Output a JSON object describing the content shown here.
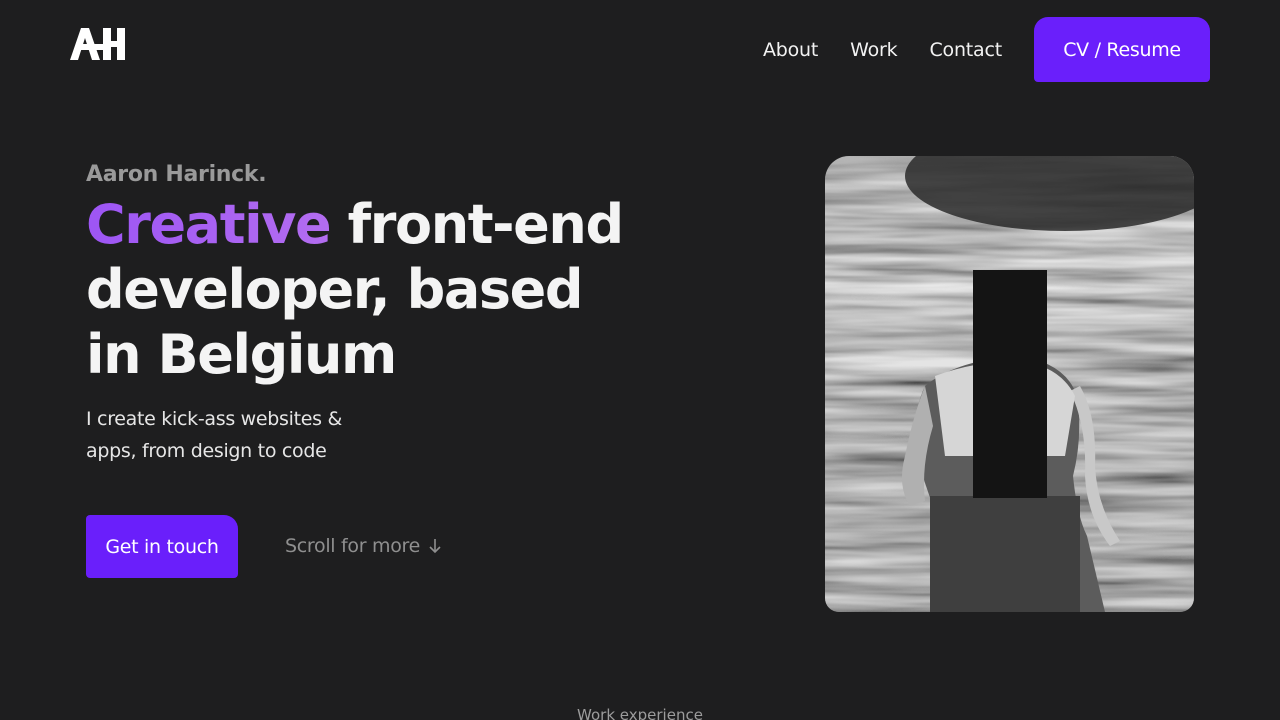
{
  "header": {
    "logo_alt": "AH",
    "nav": {
      "about": "About",
      "work": "Work",
      "contact": "Contact"
    },
    "cv_button": "CV / Resume"
  },
  "hero": {
    "name": "Aaron Harinck.",
    "headline_accent": "Creative",
    "headline_rest": " front-end developer, based in Belgium",
    "subtitle": "I create kick-ass websites & apps, from design to code",
    "cta": "Get in touch",
    "scroll": "Scroll for more"
  },
  "photo": {
    "subject": "black-and-white portrait with censor bar"
  },
  "next_section": {
    "label": "Work experience"
  },
  "colors": {
    "background": "#1e1e1f",
    "accent": "#6a1ffb",
    "gradient_text": "#9d55f4"
  },
  "icons": [
    "logo-icon",
    "arrow-down-icon"
  ]
}
